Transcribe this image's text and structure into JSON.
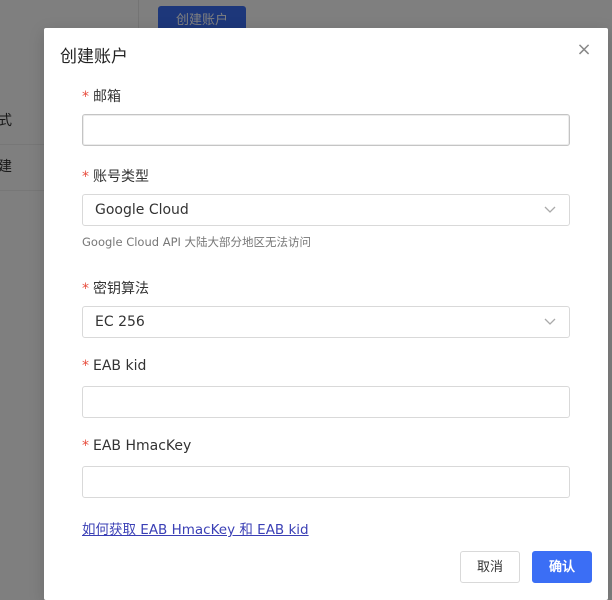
{
  "background": {
    "create_button_label": "创建账户",
    "sidebar_items": [
      "式",
      "建"
    ]
  },
  "modal": {
    "title": "创建账户",
    "close_symbol": "×",
    "required_mark": "*",
    "fields": {
      "email": {
        "label": "邮箱",
        "value": "",
        "placeholder": ""
      },
      "account_type": {
        "label": "账号类型",
        "value": "Google Cloud",
        "hint": "Google Cloud API 大陆大部分地区无法访问"
      },
      "key_algorithm": {
        "label": "密钥算法",
        "value": "EC 256"
      },
      "eab_kid": {
        "label": "EAB kid",
        "value": "",
        "placeholder": ""
      },
      "eab_hmackey": {
        "label": "EAB HmacKey",
        "value": "",
        "placeholder": ""
      }
    },
    "help_link": "如何获取 EAB HmacKey 和 EAB kid",
    "cancel_label": "取消",
    "confirm_label": "确认"
  },
  "colors": {
    "primary": "#3b6ef5",
    "required": "#e74c3c",
    "link": "#3a3fb5"
  }
}
